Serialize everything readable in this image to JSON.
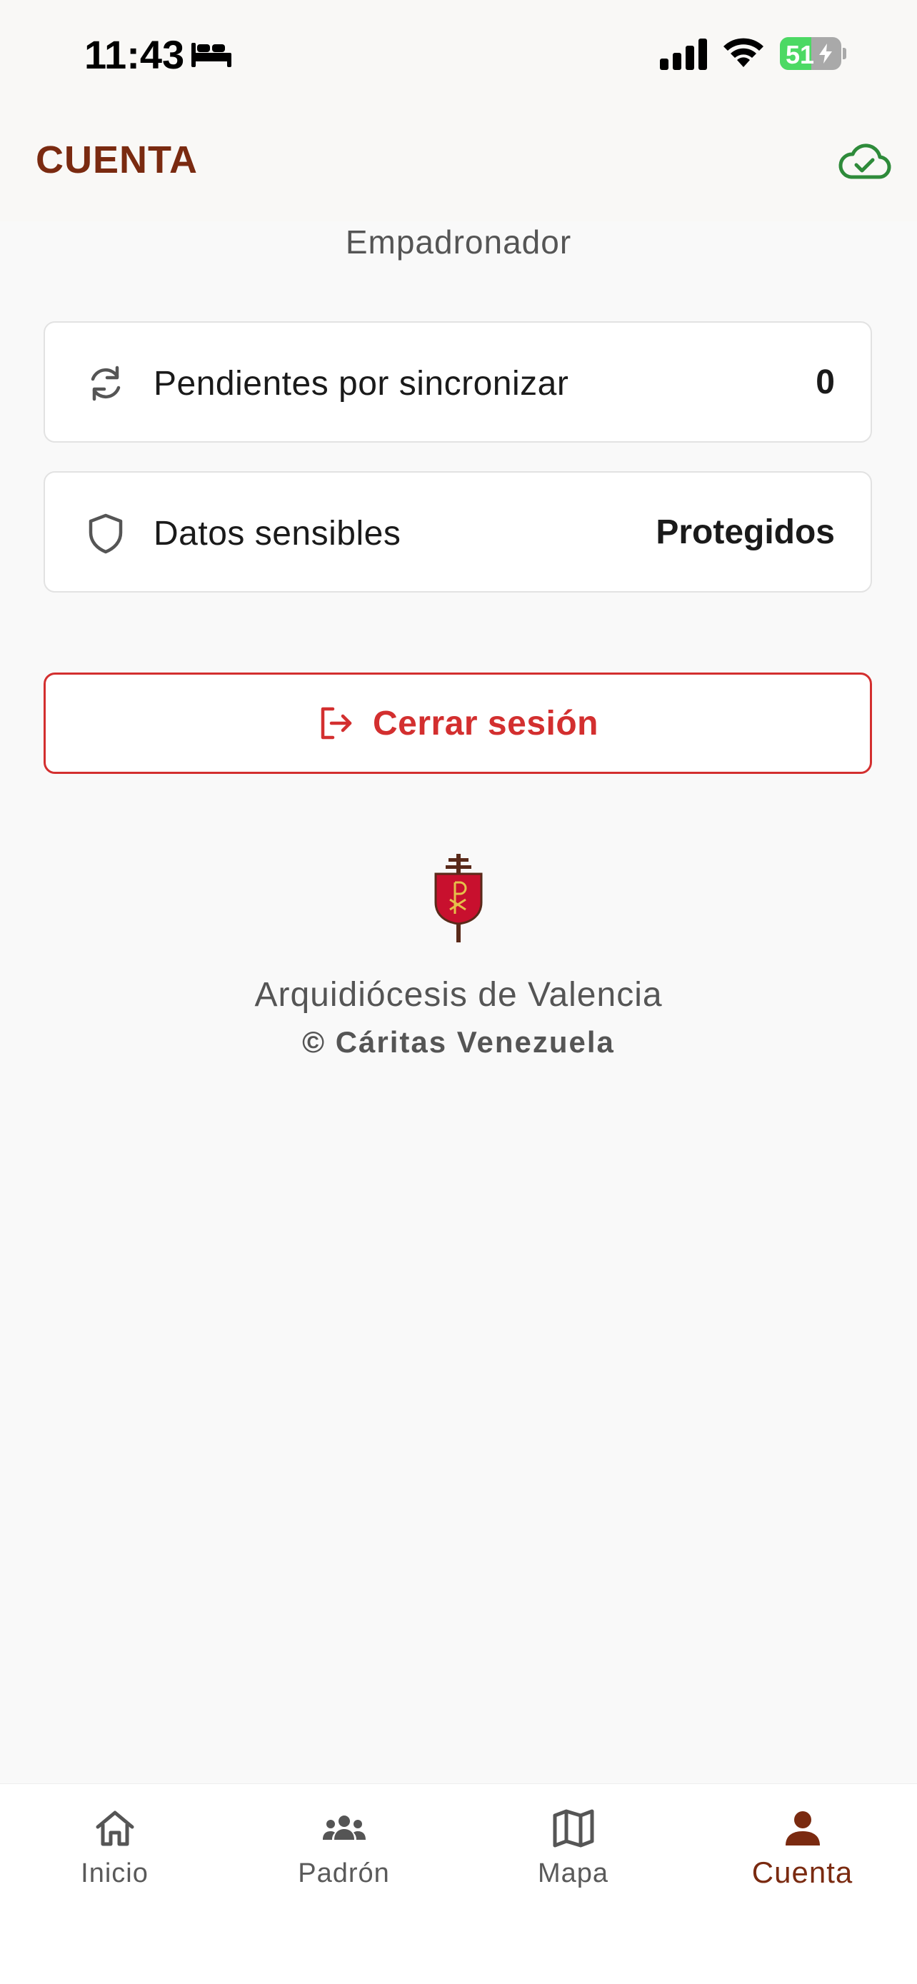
{
  "status_bar": {
    "time": "11:43",
    "battery_level": "51",
    "battery_fraction": 0.51
  },
  "header": {
    "title": "CUENTA",
    "sync_icon": "cloud-check-icon",
    "sync_color": "#2e8b3a"
  },
  "role": "Empadronador",
  "cards": {
    "sync": {
      "icon": "sync-icon",
      "label": "Pendientes por sincronizar",
      "value": "0"
    },
    "sensitive": {
      "icon": "shield-icon",
      "label": "Datos sensibles",
      "value": "Protegidos"
    }
  },
  "logout": {
    "icon": "logout-icon",
    "label": "Cerrar sesión",
    "color": "#d32f2f"
  },
  "footer": {
    "organization": "Arquidiócesis de Valencia",
    "copyright": "© Cáritas Venezuela"
  },
  "tabs": [
    {
      "icon": "home-icon",
      "label": "Inicio",
      "active": false
    },
    {
      "icon": "people-icon",
      "label": "Padrón",
      "active": false
    },
    {
      "icon": "map-icon",
      "label": "Mapa",
      "active": false
    },
    {
      "icon": "person-icon",
      "label": "Cuenta",
      "active": true
    }
  ],
  "colors": {
    "brand": "#7a2a10",
    "danger": "#d32f2f",
    "success": "#2e8b3a"
  }
}
